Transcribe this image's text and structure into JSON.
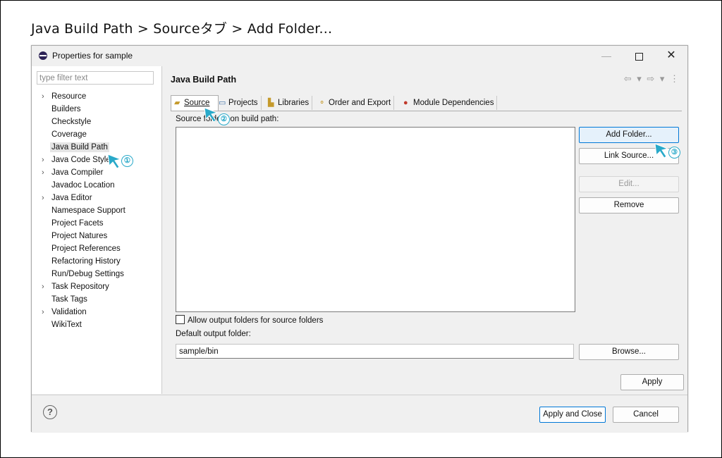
{
  "caption": "Java Build Path > Sourceタブ > Add Folder...",
  "window": {
    "title": "Properties for sample",
    "minimize": "—",
    "close": "✕"
  },
  "left_panel": {
    "filter_placeholder": "type filter text",
    "items": [
      {
        "label": "Resource",
        "expandable": true
      },
      {
        "label": "Builders",
        "expandable": false
      },
      {
        "label": "Checkstyle",
        "expandable": false
      },
      {
        "label": "Coverage",
        "expandable": false
      },
      {
        "label": "Java Build Path",
        "expandable": false,
        "selected": true
      },
      {
        "label": "Java Code Style",
        "expandable": true
      },
      {
        "label": "Java Compiler",
        "expandable": true
      },
      {
        "label": "Javadoc Location",
        "expandable": false
      },
      {
        "label": "Java Editor",
        "expandable": true
      },
      {
        "label": "Namespace Support",
        "expandable": false
      },
      {
        "label": "Project Facets",
        "expandable": false
      },
      {
        "label": "Project Natures",
        "expandable": false
      },
      {
        "label": "Project References",
        "expandable": false
      },
      {
        "label": "Refactoring History",
        "expandable": false
      },
      {
        "label": "Run/Debug Settings",
        "expandable": false
      },
      {
        "label": "Task Repository",
        "expandable": true
      },
      {
        "label": "Task Tags",
        "expandable": false
      },
      {
        "label": "Validation",
        "expandable": true
      },
      {
        "label": "WikiText",
        "expandable": false
      }
    ]
  },
  "page": {
    "title": "Java Build Path",
    "nav": "⇦ ▾ ⇨ ▾ ⋮",
    "tabs": [
      "Source",
      "Projects",
      "Libraries",
      "Order and Export",
      "Module Dependencies"
    ],
    "source_label": "Source folders on build path:",
    "buttons": {
      "add_folder": "Add Folder...",
      "link_source": "Link Source...",
      "edit": "Edit...",
      "remove": "Remove",
      "browse": "Browse..."
    },
    "allow_output_label": "Allow output folders for source folders",
    "allow_output_checked": false,
    "default_output_label": "Default output folder:",
    "default_output_value": "sample/bin",
    "apply": "Apply"
  },
  "footer": {
    "help": "?",
    "apply_and_close": "Apply and Close",
    "cancel": "Cancel"
  },
  "annotations": {
    "step1": "①",
    "step2": "②",
    "step3": "③",
    "cursor_color": "#29a9c9"
  }
}
